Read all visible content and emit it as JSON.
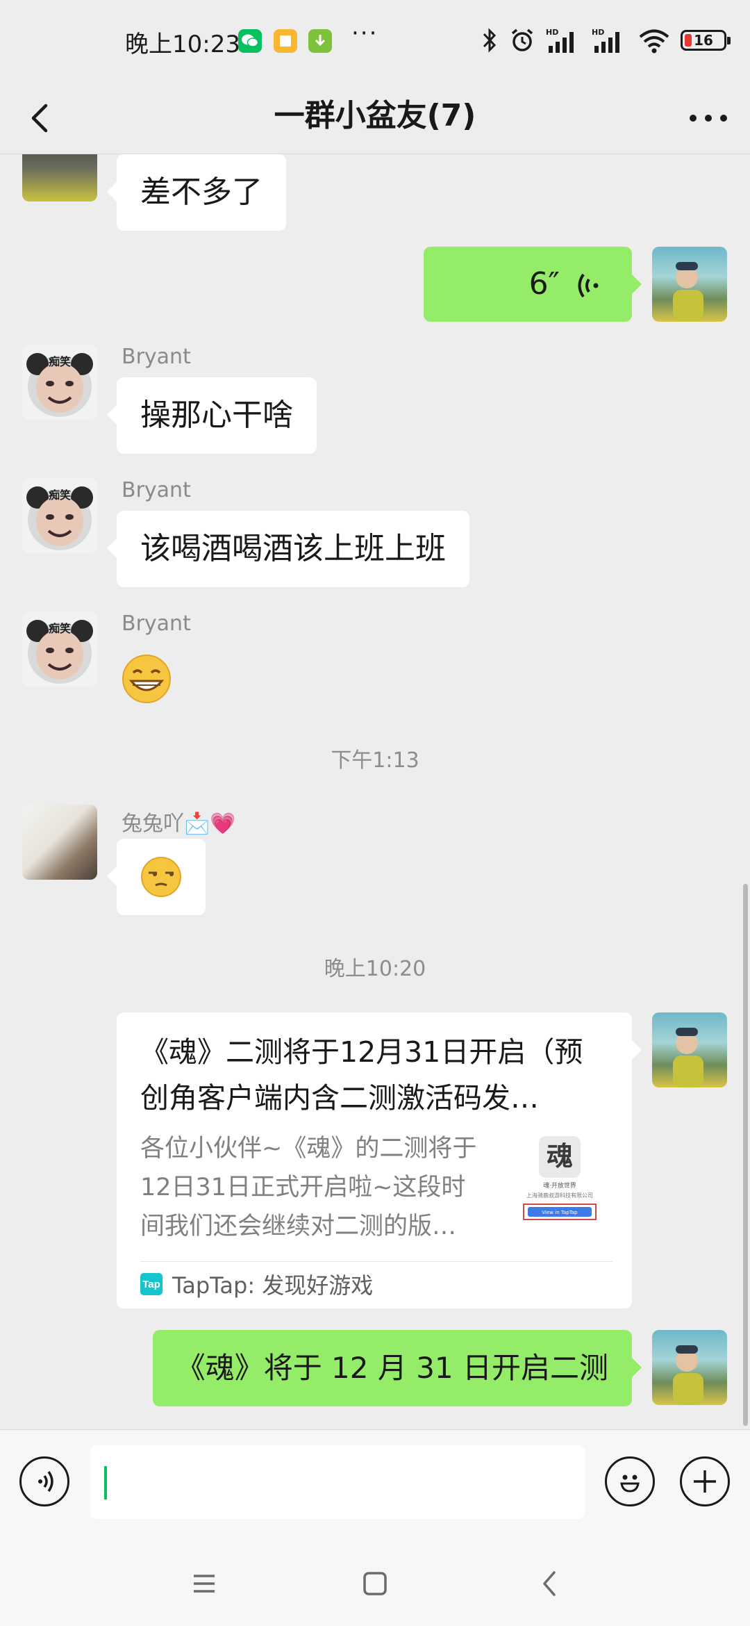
{
  "status_bar": {
    "time": "晚上10:23",
    "more_indicator": "···",
    "battery_level": "16",
    "icons": [
      "wechat-icon",
      "notes-app-icon",
      "download-app-icon",
      "bluetooth-icon",
      "alarm-icon",
      "hd-signal-icon",
      "hd-signal-icon",
      "wifi-icon",
      "battery-icon"
    ]
  },
  "header": {
    "title": "一群小盆友(7)",
    "back_icon": "chevron-left-icon",
    "more_icon": "more-dots-icon"
  },
  "messages": [
    {
      "id": "m1",
      "from": "incoming",
      "text": "差不多了"
    },
    {
      "id": "m2",
      "from": "me",
      "type": "voice",
      "duration": "6″"
    },
    {
      "id": "m3",
      "from": "incoming",
      "sender": "Bryant",
      "avatar_label": "痴笑",
      "text": "操那心干啥"
    },
    {
      "id": "m4",
      "from": "incoming",
      "sender": "Bryant",
      "avatar_label": "痴笑",
      "text": "该喝酒喝酒该上班上班"
    },
    {
      "id": "m5",
      "from": "incoming",
      "sender": "Bryant",
      "avatar_label": "痴笑",
      "type": "emoji",
      "emoji": "grinning-face"
    },
    {
      "id": "t1",
      "type": "time",
      "text": "下午1:13"
    },
    {
      "id": "m6",
      "from": "incoming",
      "sender": "兔兔吖📩💗",
      "type": "emoji",
      "emoji": "unamused-face"
    },
    {
      "id": "t2",
      "type": "time",
      "text": "晚上10:20"
    },
    {
      "id": "m7",
      "from": "me",
      "type": "link_card",
      "title": "《魂》二测将于12月31日开启（预\n创角客户端内含二测激活码发…",
      "description": "各位小伙伴~《魂》的二测将于\n12日31日正式开启啦~这段时\n间我们还会继续对二测的版…",
      "thumb_caption": "魂·开放世界",
      "thumb_company": "上海骑鹿叔游科技有限公司",
      "thumb_button": "View in TapTap",
      "source": "TapTap: 发现好游戏",
      "source_logo": "Tap"
    },
    {
      "id": "m8",
      "from": "me",
      "text": "《魂》将于 12 月 31 日开启二测"
    }
  ],
  "input_bar": {
    "voice_icon": "voice-toggle-icon",
    "value": "",
    "emoji_icon": "smiley-icon",
    "plus_icon": "plus-icon"
  },
  "nav_bar": {
    "icons": [
      "menu-icon",
      "home-square-icon",
      "back-chevron-icon"
    ]
  },
  "colors": {
    "bubble_me": "#95ec69",
    "bubble_in": "#ffffff",
    "background": "#ededed",
    "caret": "#07c160",
    "battery_low": "#e53935",
    "taptap": "#15c5ce"
  }
}
